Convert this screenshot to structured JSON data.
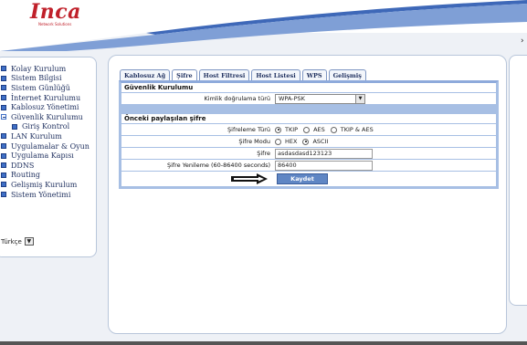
{
  "brand": {
    "logo": "Inca",
    "tagline": "Network Solutions"
  },
  "sidebar": {
    "items": [
      {
        "label": "Kolay Kurulum",
        "icon": "square-bullet-icon"
      },
      {
        "label": "Sistem Bilgisi",
        "icon": "square-bullet-icon"
      },
      {
        "label": "Sistem Günlüğü",
        "icon": "square-bullet-icon"
      },
      {
        "label": "İnternet Kurulumu",
        "icon": "square-bullet-icon"
      },
      {
        "label": "Kablosuz Yönetimi",
        "icon": "square-bullet-icon"
      },
      {
        "label": "Güvenlik Kurulumu",
        "icon": "minus-box-icon"
      },
      {
        "label": "Giriş Kontrol",
        "icon": "square-bullet-icon",
        "sub": true
      },
      {
        "label": "LAN Kurulum",
        "icon": "square-bullet-icon"
      },
      {
        "label": "Uygulamalar & Oyun",
        "icon": "square-bullet-icon"
      },
      {
        "label": "Uygulama Kapısı",
        "icon": "square-bullet-icon"
      },
      {
        "label": "DDNS",
        "icon": "square-bullet-icon"
      },
      {
        "label": "Routing",
        "icon": "square-bullet-icon"
      },
      {
        "label": "Gelişmiş Kurulum",
        "icon": "square-bullet-icon"
      },
      {
        "label": "Sistem Yönetimi",
        "icon": "square-bullet-icon"
      }
    ],
    "language": "Türkçe"
  },
  "tabs": [
    {
      "label": "Kablosuz Ağ",
      "active": false
    },
    {
      "label": "Şifre",
      "active": true
    },
    {
      "label": "Host Filtresi",
      "active": false
    },
    {
      "label": "Host Listesi",
      "active": false
    },
    {
      "label": "WPS",
      "active": false
    },
    {
      "label": "Gelişmiş",
      "active": false
    }
  ],
  "security": {
    "heading": "Güvenlik Kurulumu",
    "auth_label": "Kimlik doğrulama türü",
    "auth_value": "WPA-PSK"
  },
  "psk": {
    "heading": "Önceki paylaşılan şifre",
    "encryption_label": "Şifreleme Türü",
    "encryption_options": [
      "TKIP",
      "AES",
      "TKIP & AES"
    ],
    "encryption_selected": "TKIP",
    "mode_label": "Şifre Modu",
    "mode_options": [
      "HEX",
      "ASCII"
    ],
    "mode_selected": "ASCII",
    "password_label": "Şifre",
    "password_value": "asdasdasd123123",
    "renew_label": "Şifre Yenileme (60-86400 seconds)",
    "renew_value": "86400",
    "save_label": "Kaydet"
  },
  "colors": {
    "accent": "#5f86c4",
    "panel_border": "#a7bfe4",
    "brand": "#c0202a"
  }
}
